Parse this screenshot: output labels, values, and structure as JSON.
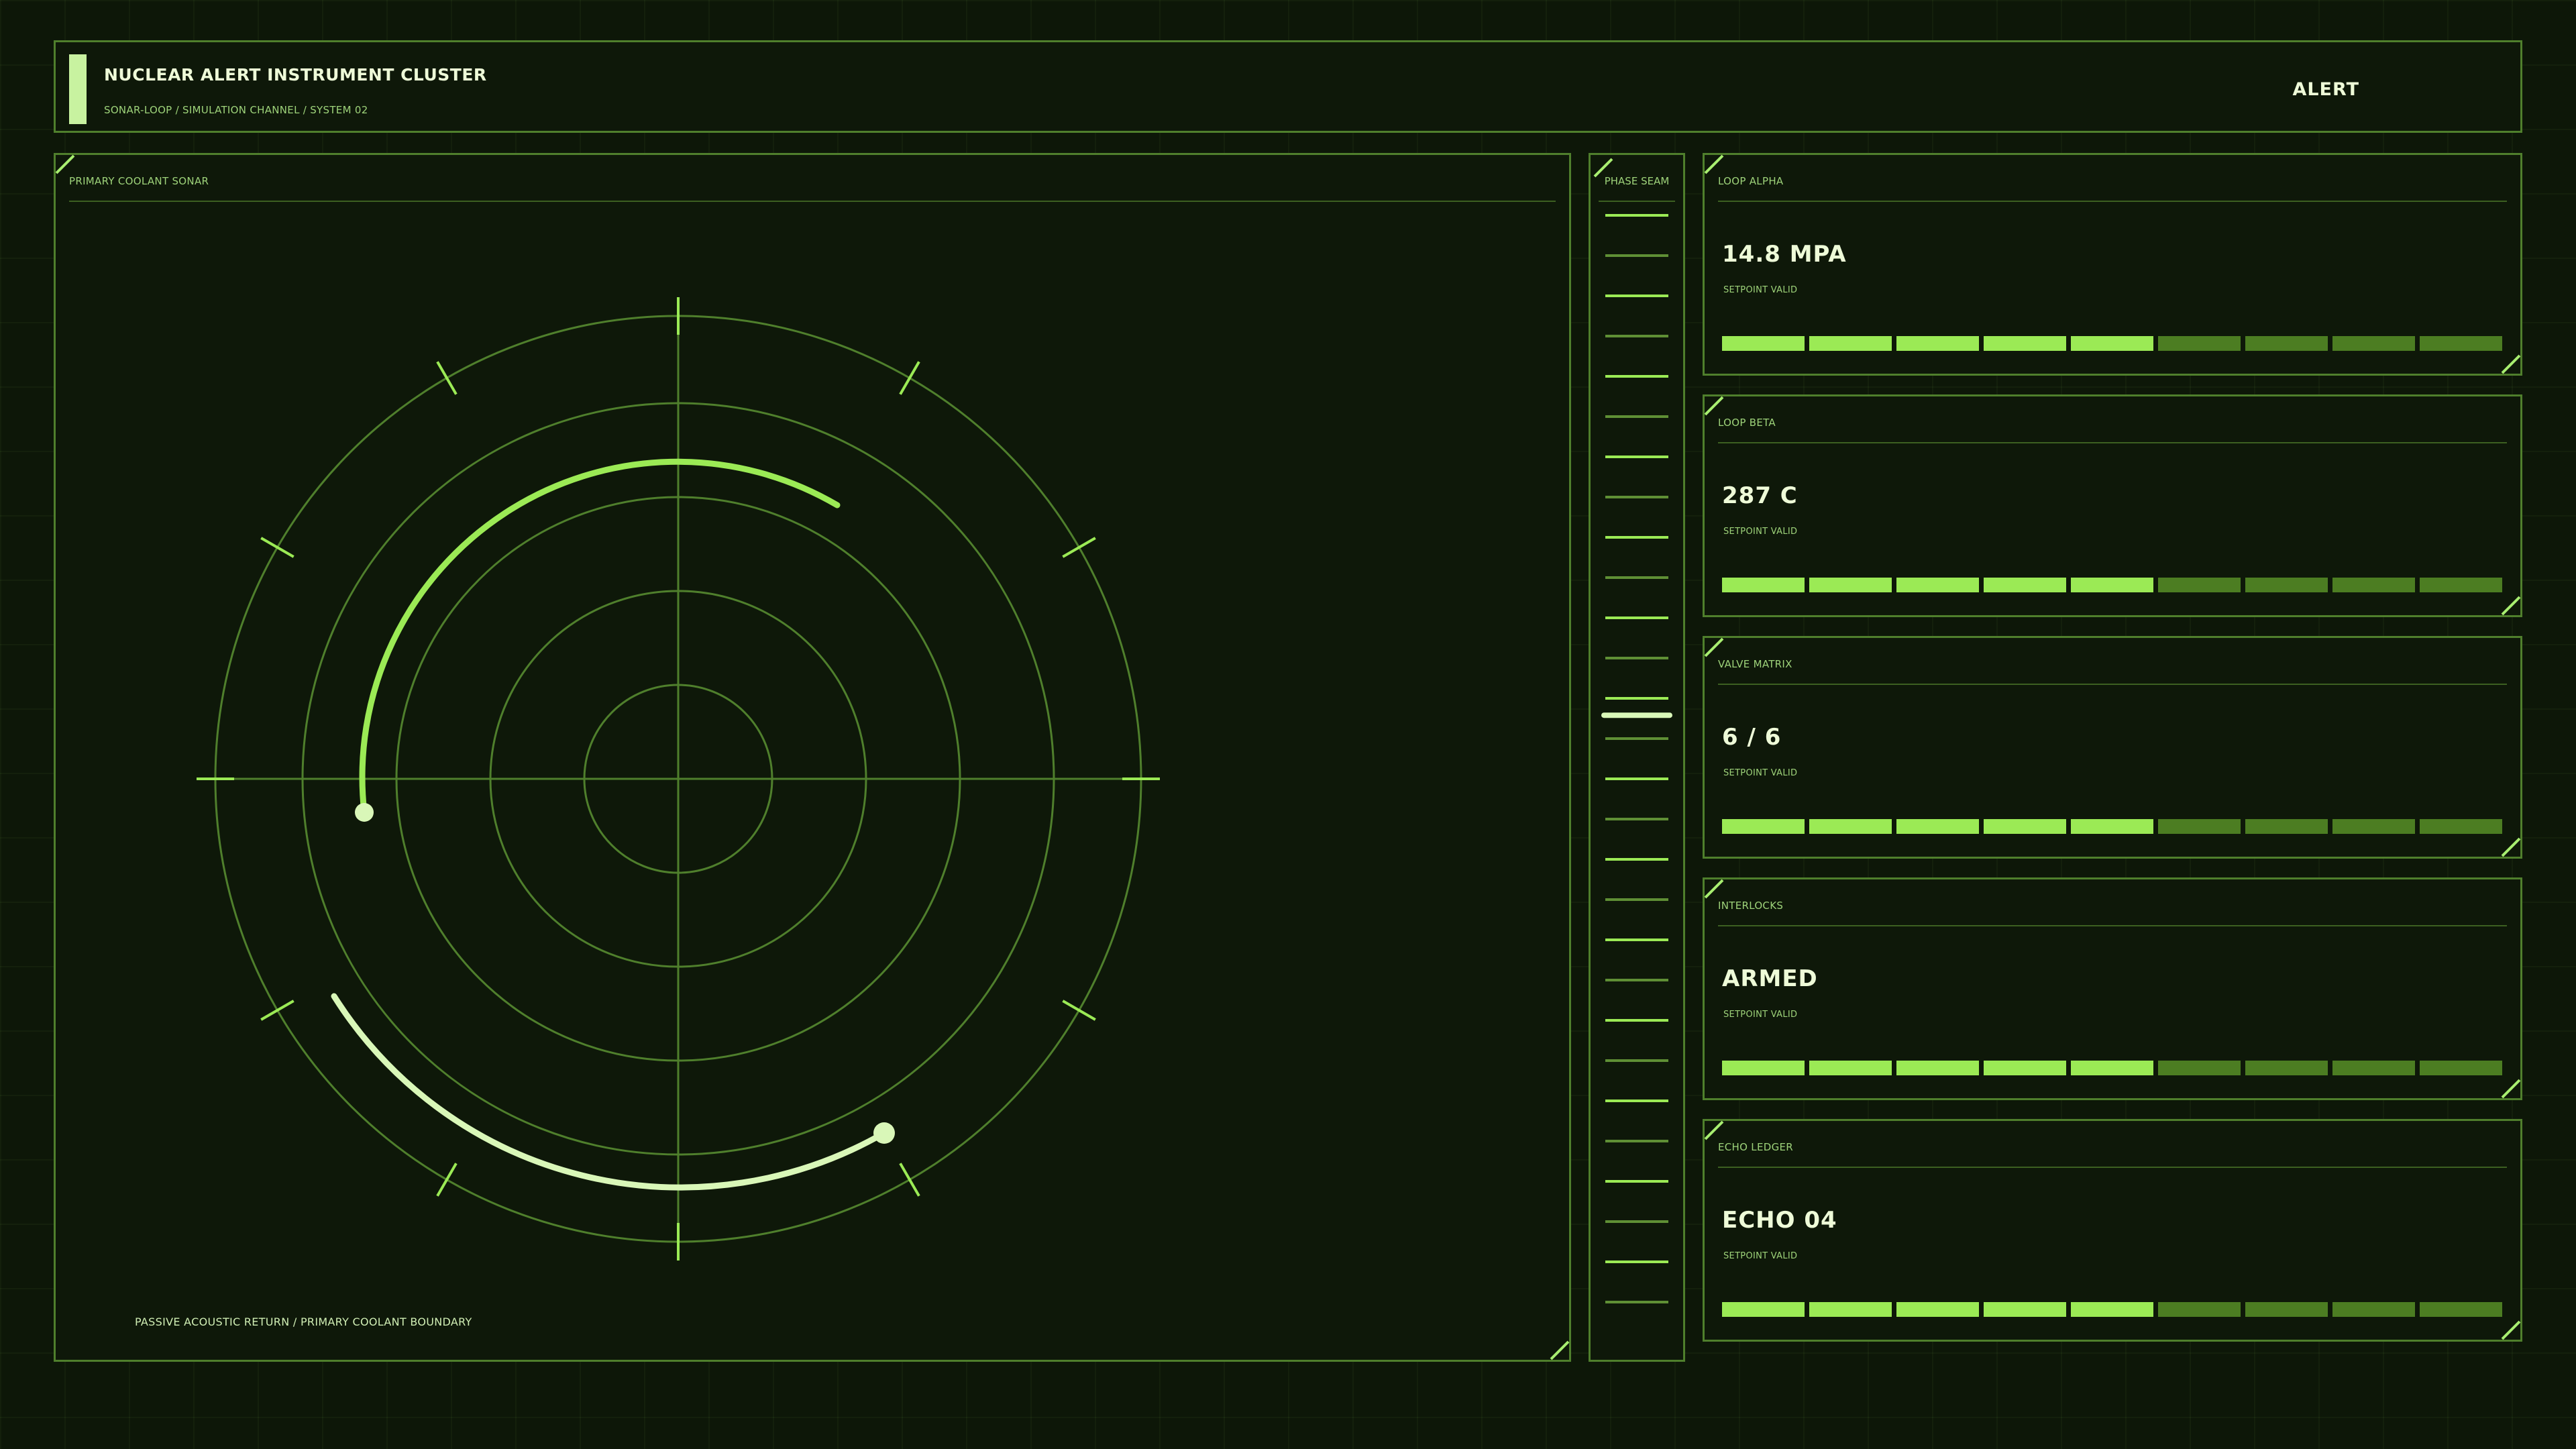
{
  "header": {
    "title": "NUCLEAR ALERT INSTRUMENT CLUSTER",
    "subtitle": "SONAR-LOOP / SIMULATION CHANNEL / SYSTEM 02",
    "alert_label": "ALERT"
  },
  "sonar": {
    "label": "PRIMARY COOLANT SONAR",
    "footer": "PASSIVE ACOUSTIC RETURN / PRIMARY COOLANT BOUNDARY"
  },
  "seam": {
    "label": "PHASE SEAM",
    "marker_level": 0.46
  },
  "cards": [
    {
      "label": "LOOP ALPHA",
      "value": "14.8 MPA",
      "status": "SETPOINT VALID",
      "segments_on": 5,
      "segments_total": 9
    },
    {
      "label": "LOOP BETA",
      "value": "287 C",
      "status": "SETPOINT VALID",
      "segments_on": 5,
      "segments_total": 9
    },
    {
      "label": "VALVE MATRIX",
      "value": "6 / 6",
      "status": "SETPOINT VALID",
      "segments_on": 5,
      "segments_total": 9
    },
    {
      "label": "INTERLOCKS",
      "value": "ARMED",
      "status": "SETPOINT VALID",
      "segments_on": 5,
      "segments_total": 9
    },
    {
      "label": "ECHO LEDGER",
      "value": "ECHO 04",
      "status": "SETPOINT VALID",
      "segments_on": 5,
      "segments_total": 9
    }
  ],
  "colors": {
    "background": "#0d1708",
    "frame": "#4f7f2c",
    "accent": "#9bea55",
    "highlight": "#d9f7b8",
    "dim_segment": "#4c7d22"
  }
}
